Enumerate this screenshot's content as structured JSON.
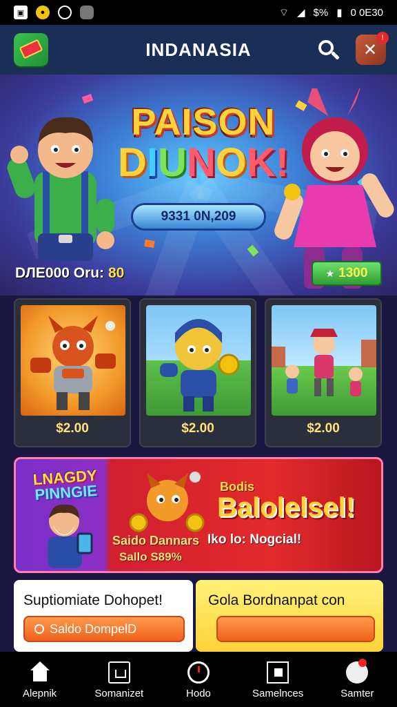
{
  "status_bar": {
    "signal_text": "$%",
    "time": "0 0E30"
  },
  "header": {
    "title": "INDANASIA"
  },
  "hero": {
    "title_line1": "PAISON",
    "title_line2_parts": [
      "D",
      "I",
      "U",
      "N",
      "O",
      "K!"
    ],
    "prize": "9331 0N,209",
    "counter_label": "DЛЕ000 Oru:",
    "counter_value": "80",
    "coins_button": "1300"
  },
  "games": [
    {
      "price": "$2.00"
    },
    {
      "price": "$2.00"
    },
    {
      "price": "$2.00"
    }
  ],
  "promo": {
    "logo_line1": "LNAGDY",
    "logo_line2": "PINNGIE",
    "small_title": "Bodis",
    "big_title": "Balolelsel!",
    "sub_line1": "Saido Dannars",
    "sub_line2": "Sallo S89%",
    "tag": "Iko lo: Nogcial!"
  },
  "offers": [
    {
      "title": "Suptiomiate Dohopet!",
      "button": "Saldo DompelD"
    },
    {
      "title": "Gola Bordnanpat con",
      "button": ""
    }
  ],
  "nav": [
    {
      "label": "Alepnik",
      "icon": "home-icon"
    },
    {
      "label": "Somanizet",
      "icon": "scan-icon"
    },
    {
      "label": "Hodo",
      "icon": "circle-icon"
    },
    {
      "label": "Samelnces",
      "icon": "box-icon"
    },
    {
      "label": "Samter",
      "icon": "mascot-icon"
    }
  ]
}
